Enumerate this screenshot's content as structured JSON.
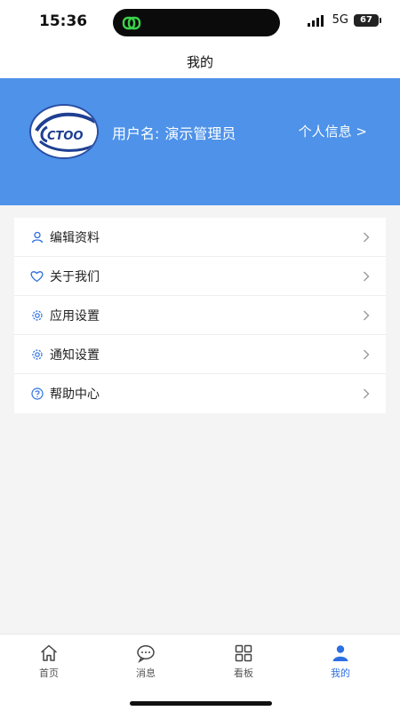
{
  "status_bar": {
    "time": "15:36",
    "network": "5G",
    "battery": "67"
  },
  "header": {
    "title": "我的"
  },
  "profile": {
    "username_label": "用户名:",
    "username_value": "演示管理员",
    "info_link": "个人信息 >",
    "logo_text": "CTOO"
  },
  "menu": {
    "items": [
      {
        "label": "编辑资料",
        "icon": "user-icon"
      },
      {
        "label": "关于我们",
        "icon": "heart-icon"
      },
      {
        "label": "应用设置",
        "icon": "gear-icon"
      },
      {
        "label": "通知设置",
        "icon": "gear-icon"
      },
      {
        "label": "帮助中心",
        "icon": "help-icon"
      }
    ]
  },
  "tabs": [
    {
      "label": "首页",
      "icon": "home-icon",
      "active": false
    },
    {
      "label": "消息",
      "icon": "message-icon",
      "active": false
    },
    {
      "label": "看板",
      "icon": "grid-icon",
      "active": false
    },
    {
      "label": "我的",
      "icon": "person-icon",
      "active": true
    }
  ],
  "colors": {
    "accent": "#2d6fe3",
    "banner": "#4e92e9",
    "background": "#f4f4f4"
  }
}
